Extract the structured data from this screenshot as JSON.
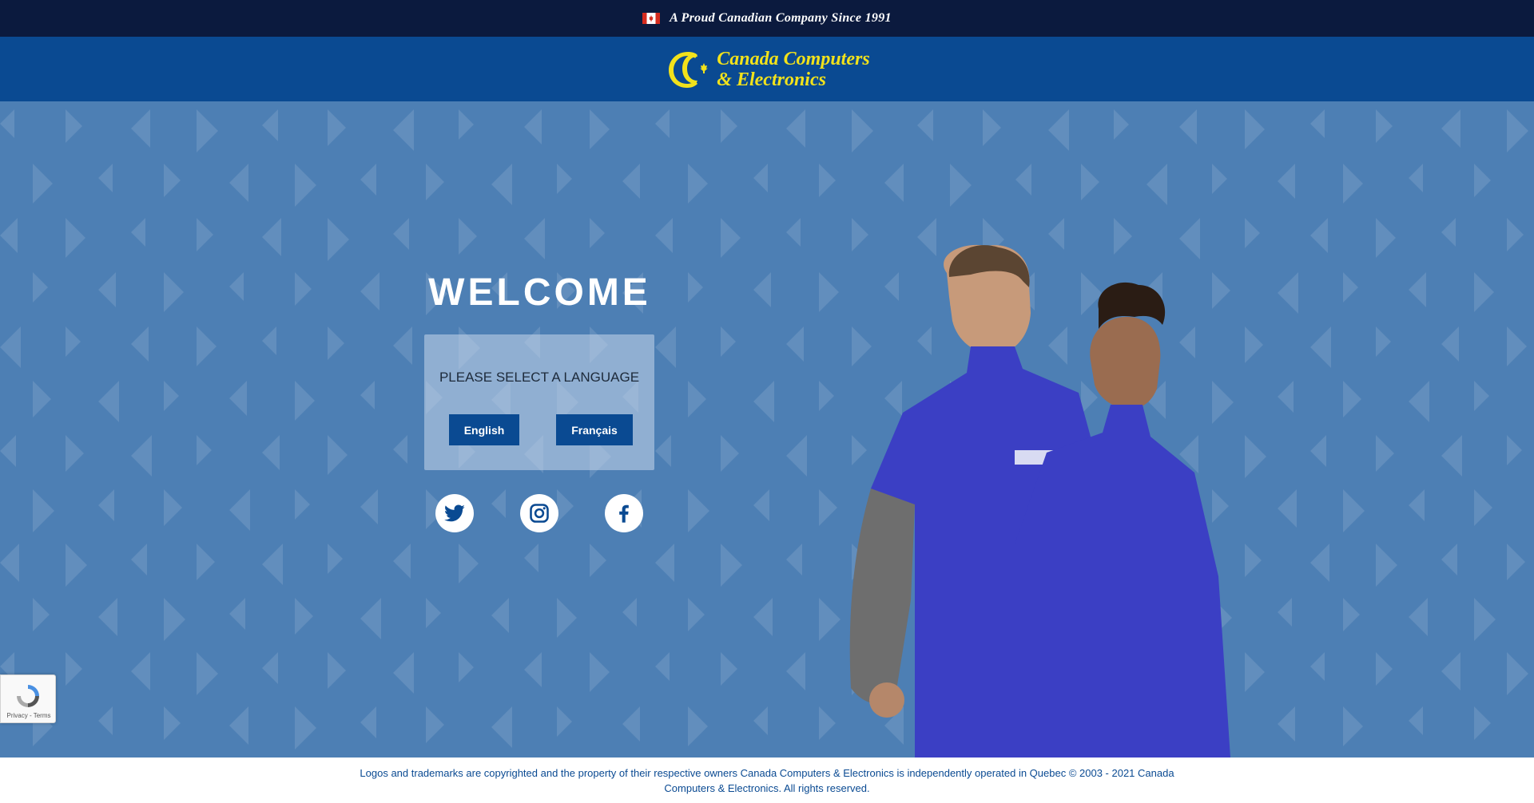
{
  "topbar": {
    "tagline": "A Proud Canadian Company Since 1991",
    "flag_icon": "canada-flag-icon"
  },
  "header": {
    "logo_line1": "Canada Computers",
    "logo_line2": "& Electronics",
    "logo_color": "#f2e21b",
    "bg_color": "#0a4a92"
  },
  "hero": {
    "welcome": "WELCOME",
    "prompt": "PLEASE SELECT A LANGUAGE",
    "english_label": "English",
    "french_label": "Français",
    "bg_color": "#4d7fb4",
    "social": [
      "twitter-icon",
      "instagram-icon",
      "facebook-icon"
    ]
  },
  "recaptcha": {
    "links": "Privacy - Terms"
  },
  "footer": {
    "text": "Logos and trademarks are copyrighted and the property of their respective owners Canada Computers & Electronics is independently operated in Quebec © 2003 - 2021 Canada Computers & Electronics. All rights reserved."
  }
}
